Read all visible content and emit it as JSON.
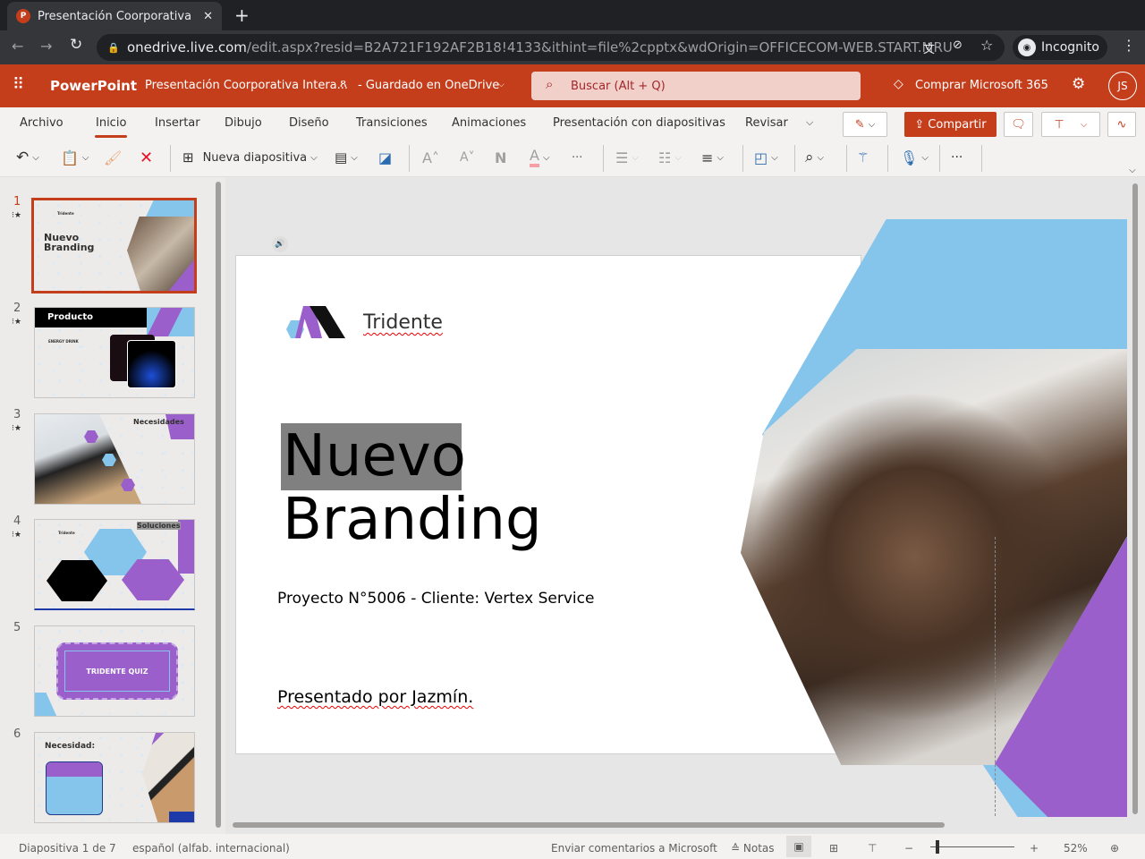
{
  "browser": {
    "tab_title": "Presentación Coorporativa",
    "url_host": "onedrive.live.com",
    "url_path": "/edit.aspx?resid=B2A721F192AF2B18!4133&ithint=file%2cpptx&wdOrigin=OFFICECOM-WEB.START.MRU",
    "incognito_label": "Incognito"
  },
  "app": {
    "name": "PowerPoint",
    "doc_title": "Presentación Coorporativa Intera...",
    "save_status": "- Guardado en OneDrive",
    "search_placeholder": "Buscar (Alt + Q)",
    "buy_label": "Comprar Microsoft 365",
    "avatar_initials": "JS",
    "accent": "#c43e1c"
  },
  "ribbon": {
    "tabs": [
      "Archivo",
      "Inicio",
      "Insertar",
      "Dibujo",
      "Diseño",
      "Transiciones",
      "Animaciones",
      "Presentación con diapositivas",
      "Revisar"
    ],
    "active_tab": "Inicio",
    "share_label": "Compartir",
    "new_slide_label": "Nueva diapositiva"
  },
  "thumbnails": [
    {
      "num": "1",
      "title": "Nuevo Branding",
      "brand": "Tridente"
    },
    {
      "num": "2",
      "title": "Producto",
      "sub": "ENERGY DRINK"
    },
    {
      "num": "3",
      "title": "Necesidades"
    },
    {
      "num": "4",
      "title": "Soluciones",
      "brand": "Tridente"
    },
    {
      "num": "5",
      "title": "TRIDENTE QUIZ"
    },
    {
      "num": "6",
      "title": "Necesidad:"
    }
  ],
  "slide": {
    "brand": "Tridente",
    "title_line1": "Nuevo",
    "title_line2": "Branding",
    "project": "Proyecto N°5006 - Cliente: Vertex Service",
    "presenter": "Presentado por Jazmín.",
    "colors": {
      "blue": "#85c5ec",
      "purple": "#9b5fcb"
    }
  },
  "status": {
    "slide_count": "Diapositiva 1 de 7",
    "language": "español (alfab. internacional)",
    "feedback": "Enviar comentarios a Microsoft",
    "notes": "Notas",
    "zoom": "52%"
  }
}
